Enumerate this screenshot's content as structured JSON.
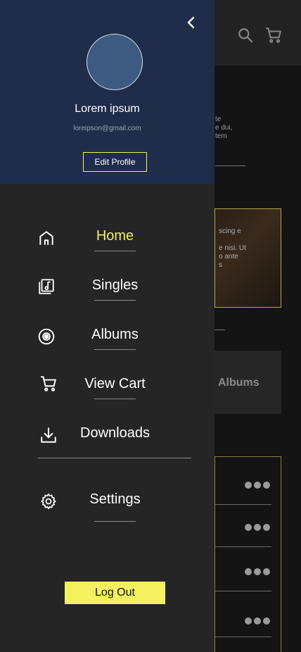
{
  "profile": {
    "name": "Lorem ipsum",
    "email": "loreipson@gmail.com",
    "edit_label": "Edit Profile"
  },
  "nav": {
    "items": [
      {
        "label": "Home",
        "icon": "home-icon",
        "active": true
      },
      {
        "label": "Singles",
        "icon": "music-library-icon",
        "active": false
      },
      {
        "label": "Albums",
        "icon": "disc-icon",
        "active": false
      },
      {
        "label": "View Cart",
        "icon": "cart-icon",
        "active": false
      },
      {
        "label": "Downloads",
        "icon": "download-icon",
        "active": false
      },
      {
        "label": "Settings",
        "icon": "gear-icon",
        "active": false
      }
    ]
  },
  "logout_label": "Log Out",
  "background": {
    "text_lines": [
      "te",
      "e dui,",
      "",
      "tem"
    ],
    "card_lines": [
      "scing e",
      "",
      "e nisi. Ut",
      "o ante",
      "s"
    ],
    "albums_label": "Albums"
  },
  "colors": {
    "accent": "#f5f060",
    "header_bg": "#1f2d4a",
    "drawer_bg": "#252525"
  }
}
